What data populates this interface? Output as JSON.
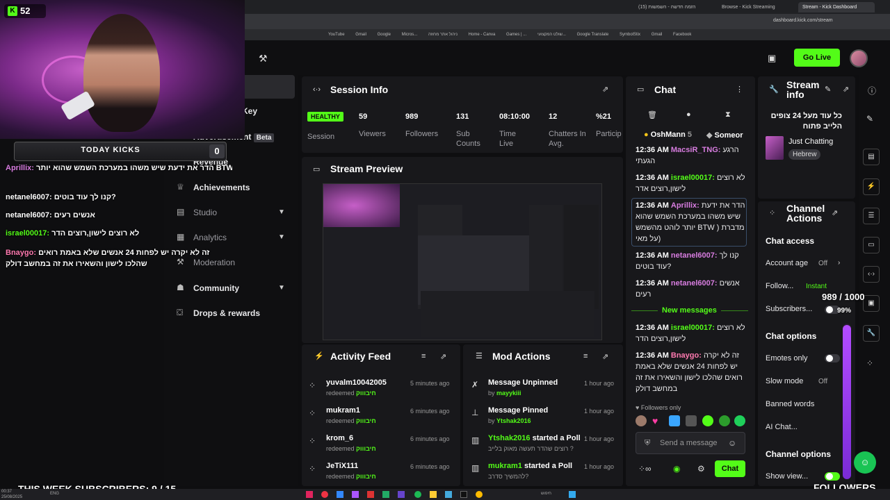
{
  "browser": {
    "tabs": [
      "(15) הזמה חדשה - השמשות",
      "Browse - Kick Streaming",
      "Stream - Kick Dashboard"
    ],
    "url": "dashboard.kick.com/stream",
    "bookmarks": [
      "YouTube",
      "Gmail",
      "Google",
      "Micros...",
      "ניהול אתר מחוזה",
      "Home - Canva",
      "Games | ...",
      "שולט המקצועי...",
      "Google Translate",
      "SymbolStix",
      "Gmail",
      "Facebook"
    ]
  },
  "header": {
    "go_live": "Go Live"
  },
  "overlay": {
    "kick_count": "52",
    "today_kicks_label": "TODAY KICKS",
    "today_kicks_value": "0",
    "chat": [
      {
        "user": "Aprillix:",
        "text": "הדר את ידעת שיש משהו במערכת השמש שהוא יותר BTW ) מדברת על מאי) לוהט מהשמש",
        "color": "#d87de0"
      },
      {
        "user": "netanel6007:",
        "text": "קנו לך עוד בוטים?",
        "color": "#e8e8ea"
      },
      {
        "user": "netanel6007:",
        "text": "אנשים רעים",
        "color": "#e8e8ea"
      },
      {
        "user": "israel00017:",
        "text": "לא רוצים לישון,רוצים הדר",
        "color": "#53fc18"
      },
      {
        "user": "Bnaygo:",
        "text": "זה לא יקרה יש לפחות 24 אנשים שלא באמת רואים שהלכו לישון והשאירו את זה במחשב דולק",
        "color": "#ff7ab0"
      }
    ],
    "subs_banner": "THIS WEEK SUBSCRIBERS: 9 / 15",
    "followers_label": "FOLLOWERS",
    "goal_text": "989 / 1000",
    "goal_pct_label": "99%",
    "goal_fraction": 0.99
  },
  "sidebar": {
    "items": [
      {
        "label": "& Key",
        "dim": false
      },
      {
        "label": "Advertisement",
        "badge": "Beta"
      },
      {
        "label": "Revenue"
      },
      {
        "label": "Achievements"
      },
      {
        "label": "Studio"
      },
      {
        "label": "Analytics"
      },
      {
        "label": "Moderation"
      },
      {
        "label": "Community"
      },
      {
        "label": "Drops & rewards"
      }
    ]
  },
  "session": {
    "title": "Session Info",
    "status": "HEALTHY",
    "status_label": "Session",
    "stats": [
      {
        "value": "59",
        "label": "Viewers"
      },
      {
        "value": "989",
        "label": "Followers"
      },
      {
        "value": "131",
        "label": "Sub Counts"
      },
      {
        "value": "08:10:00",
        "label": "Time Live"
      },
      {
        "value": "12",
        "label": "Chatters In Avg."
      },
      {
        "value": "%21",
        "label": "Particip"
      }
    ]
  },
  "preview": {
    "title": "Stream Preview"
  },
  "activity": {
    "title": "Activity Feed",
    "items": [
      {
        "name": "yuvalm10042005",
        "action": "redeemed",
        "reward": "חיבוווק",
        "time": "5 minutes ago"
      },
      {
        "name": "mukram1",
        "action": "redeemed",
        "reward": "חיבוווק",
        "time": "6 minutes ago"
      },
      {
        "name": "krom_6",
        "action": "redeemed",
        "reward": "חיבוווק",
        "time": "6 minutes ago"
      },
      {
        "name": "JeTiX111",
        "action": "redeemed",
        "reward": "חיבוווק",
        "time": "6 minutes ago"
      }
    ]
  },
  "mod": {
    "title": "Mod Actions",
    "items": [
      {
        "title": "Message Unpinned",
        "sub_prefix": "by",
        "sub": "mayykiii",
        "time": "1 hour ago"
      },
      {
        "title": "Message Pinned",
        "sub_prefix": "by",
        "sub": "Ytshak2016",
        "time": "1 hour ago"
      },
      {
        "title_user": "Ytshak2016",
        "title": "started a Poll",
        "sub": "רוצים שהדר תעשה מאוק בלייב ?",
        "time": "1 hour ago"
      },
      {
        "title_user": "mukram1",
        "title": "started a Poll",
        "sub": "להמשיך סדרב?",
        "time": "1 hour ago"
      }
    ]
  },
  "chat": {
    "title": "Chat",
    "top_users": [
      {
        "name": "OshMann",
        "count": "5"
      },
      {
        "name": "Someor",
        "count": ""
      }
    ],
    "messages": [
      {
        "time": "12:36 AM",
        "user": "MacsiR_TNG:",
        "color": "#d87de0",
        "text": "הרגע הגעתי"
      },
      {
        "time": "12:36 AM",
        "user": "israel00017:",
        "color": "#53fc18",
        "text": "לא רוצים לישון,רוצים אדר"
      },
      {
        "time": "12:36 AM",
        "user": "Aprillix:",
        "color": "#d87de0",
        "text": "הדר את ידעת שיש משהו במערכת השמש שהוא יותר לוהט מהשמש BTW ) מדברת על מאי)"
      },
      {
        "time": "12:36 AM",
        "user": "netanel6007:",
        "color": "#d87de0",
        "text": "קנו לך עוד בוטים?"
      },
      {
        "time": "12:36 AM",
        "user": "netanel6007:",
        "color": "#d87de0",
        "text": "אנשים רעים"
      }
    ],
    "new_messages_label": "New messages",
    "new_messages": [
      {
        "time": "12:36 AM",
        "user": "israel00017:",
        "color": "#53fc18",
        "text": "לא רוצים לישון,רוצים הדר"
      },
      {
        "time": "12:36 AM",
        "user": "Bnaygo:",
        "color": "#ff7ab0",
        "text": "זה לא יקרה יש לפחות 24 אנשים שלא באמת רואים שהלכו לישון והשאירו את זה במחשב דולק"
      }
    ],
    "followers_only": "Followers only",
    "input_placeholder": "Send a message",
    "send_label": "Chat"
  },
  "stream_info": {
    "title": "Stream info",
    "stream_title": "כל עוד מעל 24 צופים הלייב פתוח",
    "category": "Just Chatting",
    "language": "Hebrew"
  },
  "channel_actions": {
    "title": "Channel Actions",
    "chat_access": "Chat access",
    "account_age": "Account age",
    "account_age_val": "Off",
    "follow": "Follow...",
    "follow_val": "Instant",
    "subscribers": "Subscribers...",
    "chat_options": "Chat options",
    "emotes_only": "Emotes only",
    "slow_mode": "Slow mode",
    "slow_mode_val": "Off",
    "banned_words": "Banned words",
    "ai_chat": "AI Chat...",
    "channel_options": "Channel options",
    "show_view": "Show view..."
  },
  "taskbar": {
    "date": "25/08/2025",
    "time": "00:37",
    "lang": "ENG",
    "search": "חיפוש"
  },
  "colors": {
    "accent": "#53fc18",
    "panel": "#18181b",
    "bg": "#0e0e10",
    "purple": "#b34cff"
  }
}
